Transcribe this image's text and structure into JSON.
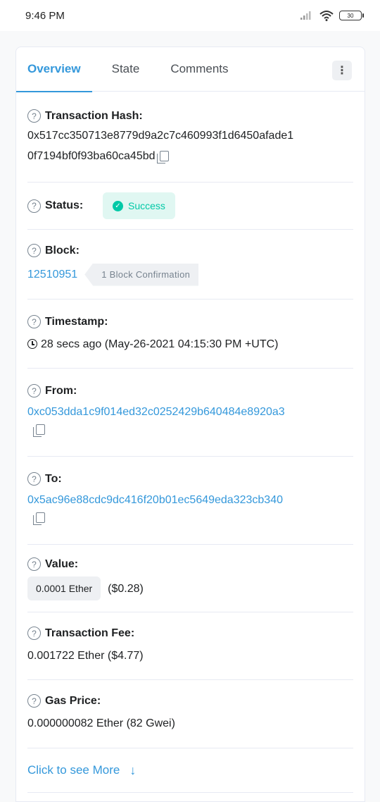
{
  "status_bar": {
    "time": "9:46 PM",
    "battery": "30"
  },
  "tabs": [
    {
      "label": "Overview",
      "active": true
    },
    {
      "label": "State",
      "active": false
    },
    {
      "label": "Comments",
      "active": false
    }
  ],
  "more_menu_glyph": "⋮",
  "transaction": {
    "hash_label": "Transaction Hash:",
    "hash_line1": "0x517cc350713e8779d9a2c7c460993f1d6450afade1",
    "hash_line2": "0f7194bf0f93ba60ca45bd",
    "status_label": "Status:",
    "status_value": "Success",
    "block_label": "Block:",
    "block_number": "12510951",
    "block_confirmation": "1 Block Confirmation",
    "timestamp_label": "Timestamp:",
    "timestamp_value": "28 secs ago (May-26-2021 04:15:30 PM +UTC)",
    "from_label": "From:",
    "from_value": "0xc053dda1c9f014ed32c0252429b640484e8920a3",
    "to_label": "To:",
    "to_value": "0x5ac96e88cdc9dc416f20b01ec5649eda323cb340",
    "value_label": "Value:",
    "value_ether": "0.0001 Ether",
    "value_usd": "($0.28)",
    "fee_label": "Transaction Fee:",
    "fee_value": "0.001722 Ether ($4.77)",
    "gas_label": "Gas Price:",
    "gas_value": "0.000000082 Ether (82 Gwei)"
  },
  "see_more": "Click to see More",
  "colors": {
    "accent": "#3498db",
    "success": "#00c9a7"
  }
}
